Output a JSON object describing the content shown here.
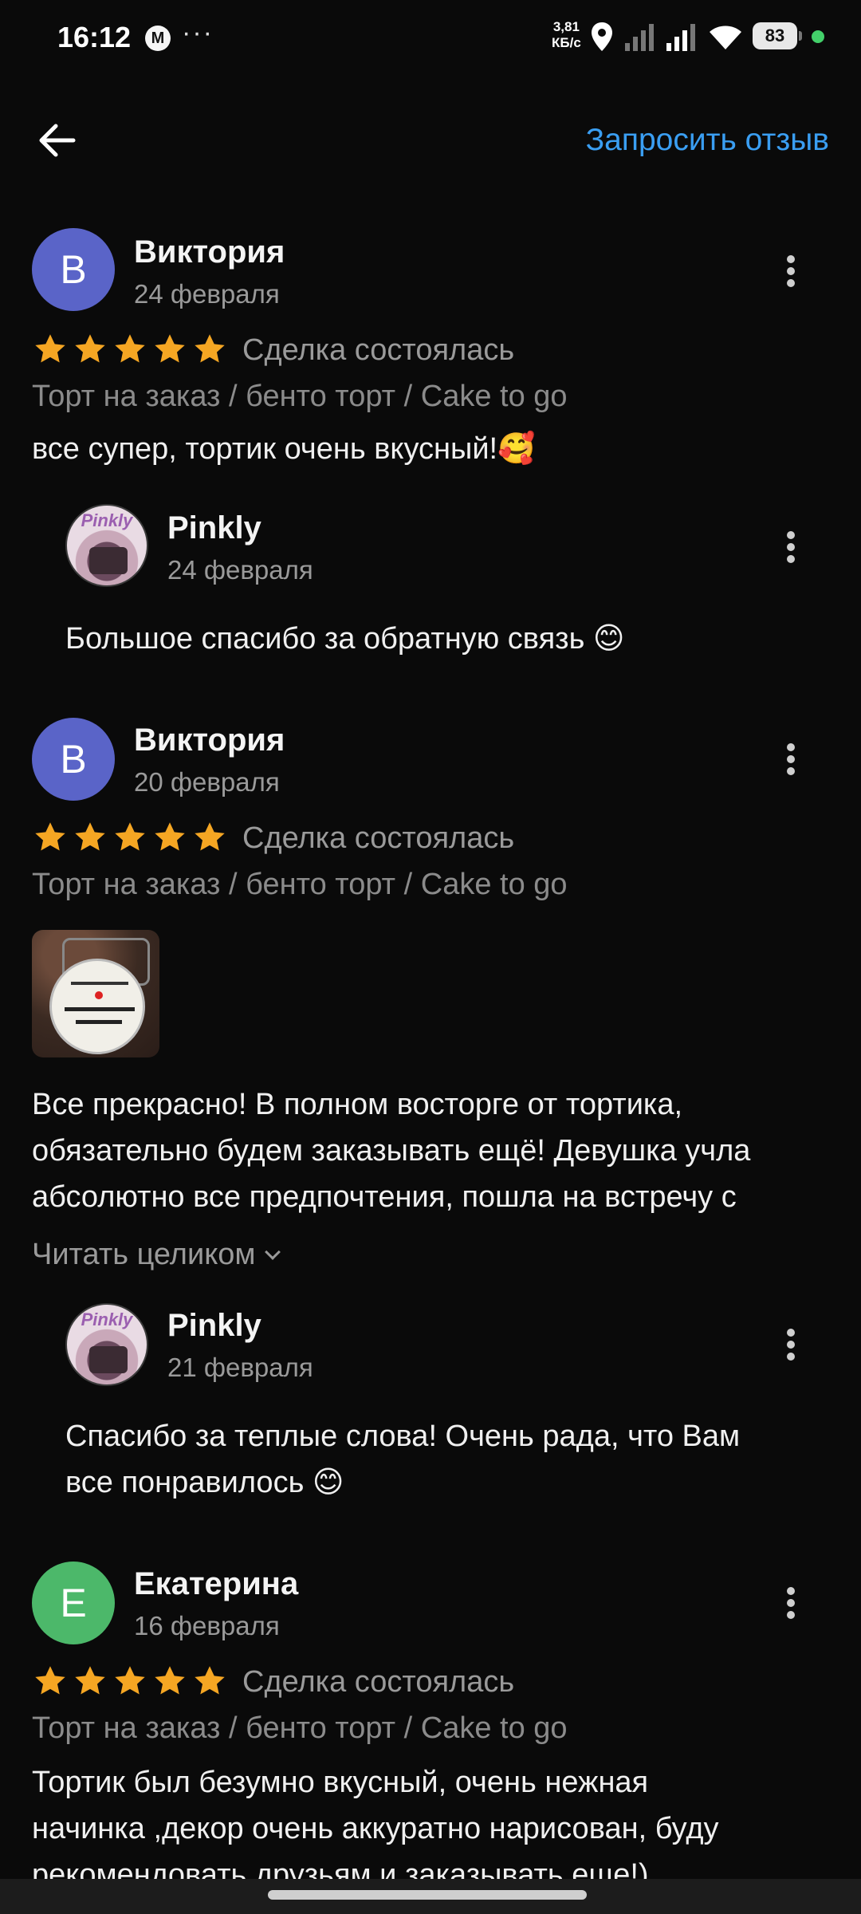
{
  "status_bar": {
    "time": "16:12",
    "mail_badge": "M",
    "dots": "···",
    "speed_value": "3,81",
    "speed_unit": "КБ/с",
    "battery": "83"
  },
  "header": {
    "request_review": "Запросить отзыв"
  },
  "reviews": [
    {
      "initial": "В",
      "author": "Виктория",
      "date": "24 февраля",
      "rating": 5,
      "deal_status": "Сделка состоялась",
      "category": "Торт на заказ / бенто торт / Cake to go",
      "text": "все супер, тортик очень вкусный!🥰",
      "reply": {
        "author": "Pinkly",
        "date": "24 февраля",
        "text": "Большое спасибо за обратную связь 😊"
      }
    },
    {
      "initial": "В",
      "author": "Виктория",
      "date": "20 февраля",
      "rating": 5,
      "deal_status": "Сделка состоялась",
      "category": "Торт на заказ / бенто торт / Cake to go",
      "text_lines": [
        "Все прекрасно! В полном восторге от тортика,",
        "обязательно будем заказывать ещё! Девушка учла",
        "абсолютно все предпочтения, пошла на встречу с"
      ],
      "read_more": "Читать целиком",
      "reply": {
        "author": "Pinkly",
        "date": "21 февраля",
        "text_lines": [
          "Спасибо за теплые слова! Очень рада, что Вам",
          "все понравилось 😊"
        ]
      }
    },
    {
      "initial": "Е",
      "author": "Екатерина",
      "date": "16 февраля",
      "rating": 5,
      "deal_status": "Сделка состоялась",
      "category": "Торт на заказ / бенто торт / Cake to go",
      "text_lines": [
        "Тортик был безумно вкусный, очень нежная",
        "начинка ,декор очень аккуратно нарисован, буду",
        "рекомендовать друзьям и заказывать еще!)"
      ]
    }
  ],
  "reply_avatar_logo": "Pinkly",
  "colors": {
    "background": "#0a0a0a",
    "accent_link": "#3a9ef2",
    "star": "#f5a623",
    "avatar_v": "#5a64c8",
    "avatar_e": "#4cb86a"
  }
}
